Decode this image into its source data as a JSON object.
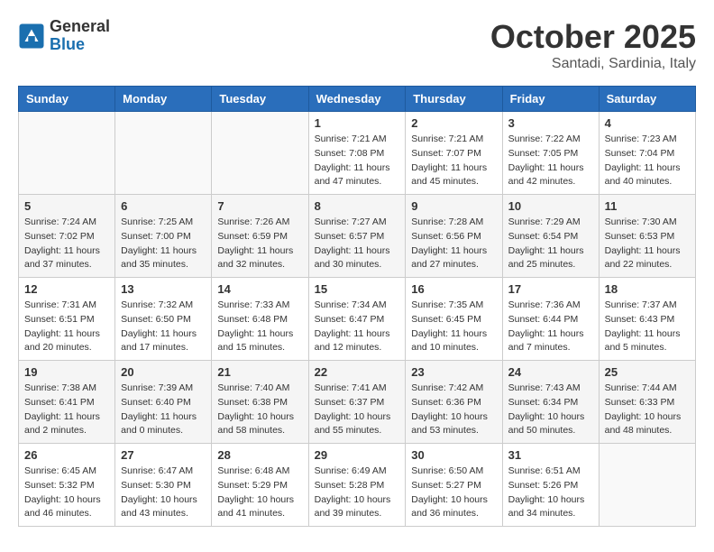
{
  "header": {
    "logo": {
      "general": "General",
      "blue": "Blue"
    },
    "title": "October 2025",
    "subtitle": "Santadi, Sardinia, Italy"
  },
  "weekdays": [
    "Sunday",
    "Monday",
    "Tuesday",
    "Wednesday",
    "Thursday",
    "Friday",
    "Saturday"
  ],
  "weeks": [
    [
      {
        "day": "",
        "info": ""
      },
      {
        "day": "",
        "info": ""
      },
      {
        "day": "",
        "info": ""
      },
      {
        "day": "1",
        "info": "Sunrise: 7:21 AM\nSunset: 7:08 PM\nDaylight: 11 hours\nand 47 minutes."
      },
      {
        "day": "2",
        "info": "Sunrise: 7:21 AM\nSunset: 7:07 PM\nDaylight: 11 hours\nand 45 minutes."
      },
      {
        "day": "3",
        "info": "Sunrise: 7:22 AM\nSunset: 7:05 PM\nDaylight: 11 hours\nand 42 minutes."
      },
      {
        "day": "4",
        "info": "Sunrise: 7:23 AM\nSunset: 7:04 PM\nDaylight: 11 hours\nand 40 minutes."
      }
    ],
    [
      {
        "day": "5",
        "info": "Sunrise: 7:24 AM\nSunset: 7:02 PM\nDaylight: 11 hours\nand 37 minutes."
      },
      {
        "day": "6",
        "info": "Sunrise: 7:25 AM\nSunset: 7:00 PM\nDaylight: 11 hours\nand 35 minutes."
      },
      {
        "day": "7",
        "info": "Sunrise: 7:26 AM\nSunset: 6:59 PM\nDaylight: 11 hours\nand 32 minutes."
      },
      {
        "day": "8",
        "info": "Sunrise: 7:27 AM\nSunset: 6:57 PM\nDaylight: 11 hours\nand 30 minutes."
      },
      {
        "day": "9",
        "info": "Sunrise: 7:28 AM\nSunset: 6:56 PM\nDaylight: 11 hours\nand 27 minutes."
      },
      {
        "day": "10",
        "info": "Sunrise: 7:29 AM\nSunset: 6:54 PM\nDaylight: 11 hours\nand 25 minutes."
      },
      {
        "day": "11",
        "info": "Sunrise: 7:30 AM\nSunset: 6:53 PM\nDaylight: 11 hours\nand 22 minutes."
      }
    ],
    [
      {
        "day": "12",
        "info": "Sunrise: 7:31 AM\nSunset: 6:51 PM\nDaylight: 11 hours\nand 20 minutes."
      },
      {
        "day": "13",
        "info": "Sunrise: 7:32 AM\nSunset: 6:50 PM\nDaylight: 11 hours\nand 17 minutes."
      },
      {
        "day": "14",
        "info": "Sunrise: 7:33 AM\nSunset: 6:48 PM\nDaylight: 11 hours\nand 15 minutes."
      },
      {
        "day": "15",
        "info": "Sunrise: 7:34 AM\nSunset: 6:47 PM\nDaylight: 11 hours\nand 12 minutes."
      },
      {
        "day": "16",
        "info": "Sunrise: 7:35 AM\nSunset: 6:45 PM\nDaylight: 11 hours\nand 10 minutes."
      },
      {
        "day": "17",
        "info": "Sunrise: 7:36 AM\nSunset: 6:44 PM\nDaylight: 11 hours\nand 7 minutes."
      },
      {
        "day": "18",
        "info": "Sunrise: 7:37 AM\nSunset: 6:43 PM\nDaylight: 11 hours\nand 5 minutes."
      }
    ],
    [
      {
        "day": "19",
        "info": "Sunrise: 7:38 AM\nSunset: 6:41 PM\nDaylight: 11 hours\nand 2 minutes."
      },
      {
        "day": "20",
        "info": "Sunrise: 7:39 AM\nSunset: 6:40 PM\nDaylight: 11 hours\nand 0 minutes."
      },
      {
        "day": "21",
        "info": "Sunrise: 7:40 AM\nSunset: 6:38 PM\nDaylight: 10 hours\nand 58 minutes."
      },
      {
        "day": "22",
        "info": "Sunrise: 7:41 AM\nSunset: 6:37 PM\nDaylight: 10 hours\nand 55 minutes."
      },
      {
        "day": "23",
        "info": "Sunrise: 7:42 AM\nSunset: 6:36 PM\nDaylight: 10 hours\nand 53 minutes."
      },
      {
        "day": "24",
        "info": "Sunrise: 7:43 AM\nSunset: 6:34 PM\nDaylight: 10 hours\nand 50 minutes."
      },
      {
        "day": "25",
        "info": "Sunrise: 7:44 AM\nSunset: 6:33 PM\nDaylight: 10 hours\nand 48 minutes."
      }
    ],
    [
      {
        "day": "26",
        "info": "Sunrise: 6:45 AM\nSunset: 5:32 PM\nDaylight: 10 hours\nand 46 minutes."
      },
      {
        "day": "27",
        "info": "Sunrise: 6:47 AM\nSunset: 5:30 PM\nDaylight: 10 hours\nand 43 minutes."
      },
      {
        "day": "28",
        "info": "Sunrise: 6:48 AM\nSunset: 5:29 PM\nDaylight: 10 hours\nand 41 minutes."
      },
      {
        "day": "29",
        "info": "Sunrise: 6:49 AM\nSunset: 5:28 PM\nDaylight: 10 hours\nand 39 minutes."
      },
      {
        "day": "30",
        "info": "Sunrise: 6:50 AM\nSunset: 5:27 PM\nDaylight: 10 hours\nand 36 minutes."
      },
      {
        "day": "31",
        "info": "Sunrise: 6:51 AM\nSunset: 5:26 PM\nDaylight: 10 hours\nand 34 minutes."
      },
      {
        "day": "",
        "info": ""
      }
    ]
  ]
}
